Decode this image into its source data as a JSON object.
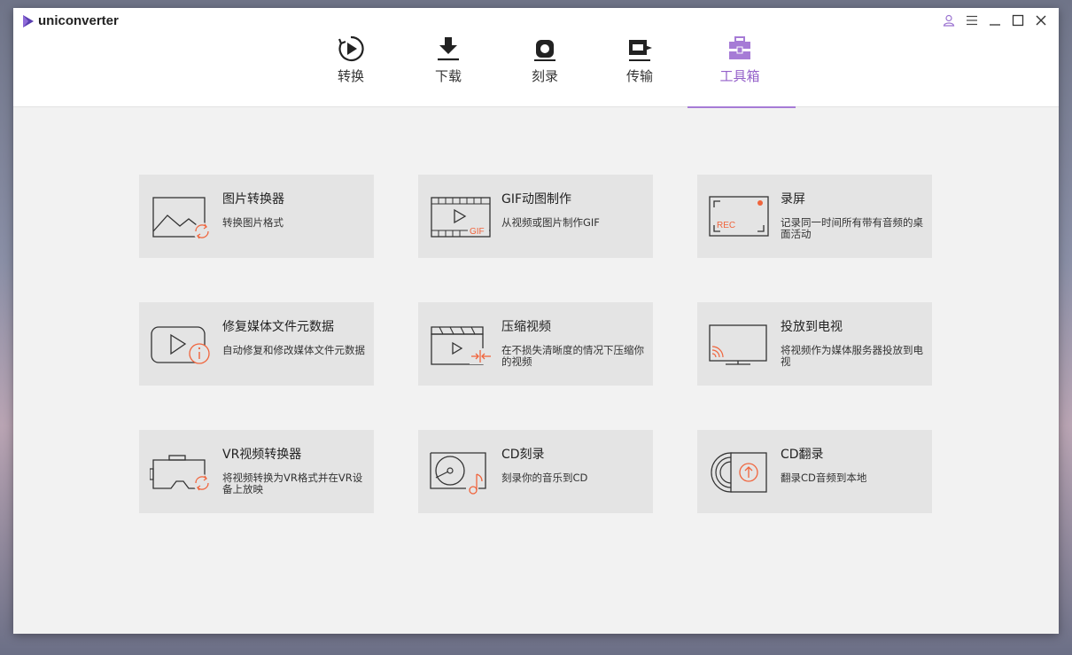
{
  "app": {
    "name": "uniconverter"
  },
  "nav": {
    "tabs": [
      {
        "label": "转换",
        "icon": "convert-icon"
      },
      {
        "label": "下载",
        "icon": "download-icon"
      },
      {
        "label": "刻录",
        "icon": "burn-icon"
      },
      {
        "label": "传输",
        "icon": "transfer-icon"
      },
      {
        "label": "工具箱",
        "icon": "toolbox-icon",
        "active": true
      }
    ]
  },
  "colors": {
    "accent": "#a67bd6",
    "icon_orange": "#f0643c",
    "card_bg": "#e4e4e4"
  },
  "tools": [
    {
      "title": "图片转换器",
      "desc": "转换图片格式",
      "icon": "image-convert-icon"
    },
    {
      "title": "GIF动图制作",
      "desc": "从视频或图片制作GIF",
      "icon": "gif-maker-icon"
    },
    {
      "title": "录屏",
      "desc": "记录同一时间所有带有音频的桌面活动",
      "icon": "screen-record-icon"
    },
    {
      "title": "修复媒体文件元数据",
      "desc": "自动修复和修改媒体文件元数据",
      "icon": "fix-metadata-icon"
    },
    {
      "title": "压缩视频",
      "desc": "在不损失清晰度的情况下压缩你的视频",
      "icon": "compress-video-icon"
    },
    {
      "title": "投放到电视",
      "desc": "将视频作为媒体服务器投放到电视",
      "icon": "cast-tv-icon"
    },
    {
      "title": "VR视频转换器",
      "desc": "将视频转换为VR格式并在VR设备上放映",
      "icon": "vr-convert-icon"
    },
    {
      "title": "CD刻录",
      "desc": "刻录你的音乐到CD",
      "icon": "cd-burn-icon"
    },
    {
      "title": "CD翻录",
      "desc": "翻录CD音频到本地",
      "icon": "cd-rip-icon"
    }
  ]
}
